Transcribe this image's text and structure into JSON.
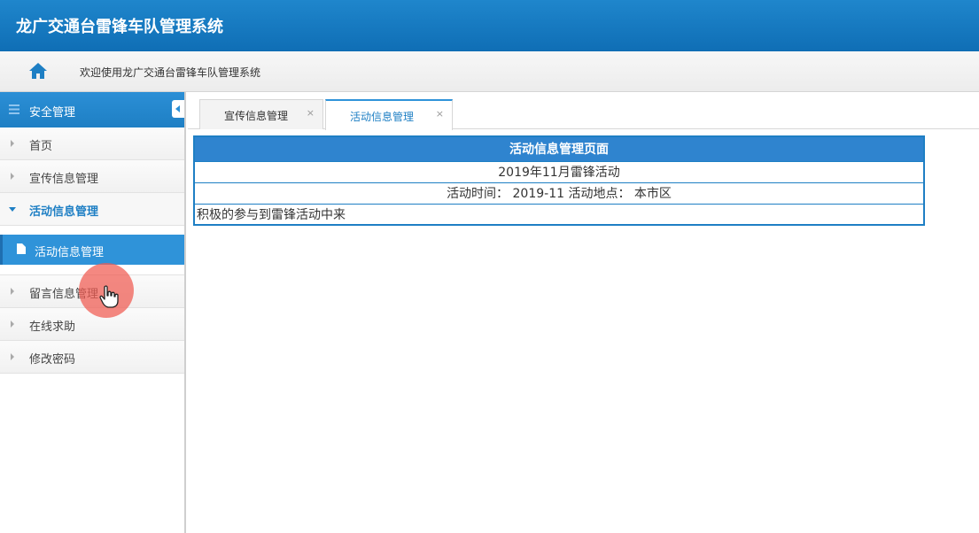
{
  "app": {
    "title": "龙广交通台雷锋车队管理系统"
  },
  "welcome": {
    "text": "欢迎使用龙广交通台雷锋车队管理系统",
    "icon": "home-icon"
  },
  "sidebar": {
    "header": "安全管理",
    "items": [
      {
        "label": "首页"
      },
      {
        "label": "宣传信息管理"
      },
      {
        "label": "活动信息管理",
        "expanded": true,
        "children": [
          {
            "label": "活动信息管理",
            "selected": true
          }
        ]
      },
      {
        "label": "留言信息管理"
      },
      {
        "label": "在线求助"
      },
      {
        "label": "修改密码"
      }
    ]
  },
  "tabs": [
    {
      "label": "宣传信息管理",
      "close": "×",
      "active": false
    },
    {
      "label": "活动信息管理",
      "close": "×",
      "active": true
    }
  ],
  "main": {
    "table_title": "活动信息管理页面",
    "activity_name": "2019年11月雷锋活动",
    "activity_meta": "活动时间： 2019-11 活动地点： 本市区",
    "activity_desc": "积极的参与到雷锋活动中来"
  },
  "colors": {
    "primary": "#1e7fc4",
    "header_bar": "#1a7bc4",
    "cursor_highlight": "#f05a50"
  }
}
